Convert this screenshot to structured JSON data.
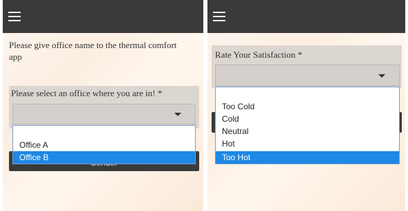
{
  "left_panel": {
    "menu_icon": "hamburger-icon",
    "info_text": "Please give office name to the thermal comfort app",
    "office_label": "Please select an office where you are in! *",
    "office_select_value": "",
    "office_options": [
      "",
      "Office A",
      "Office B"
    ],
    "selected_option": "Office B",
    "send_label": "Sender"
  },
  "right_panel": {
    "menu_icon": "hamburger-icon",
    "satisfaction_label": "Rate Your Satisfaction *",
    "satisfaction_select_value": "",
    "satisfaction_options": [
      "",
      "Too Cold",
      "Cold",
      "Neutral",
      "Hot",
      "Too Hot"
    ],
    "selected_option": "Too Hot"
  },
  "colors": {
    "topbar": "#3a3a3a",
    "selected_option_bg": "#1e88e5",
    "dropdown_border": "#7a9ccc"
  }
}
